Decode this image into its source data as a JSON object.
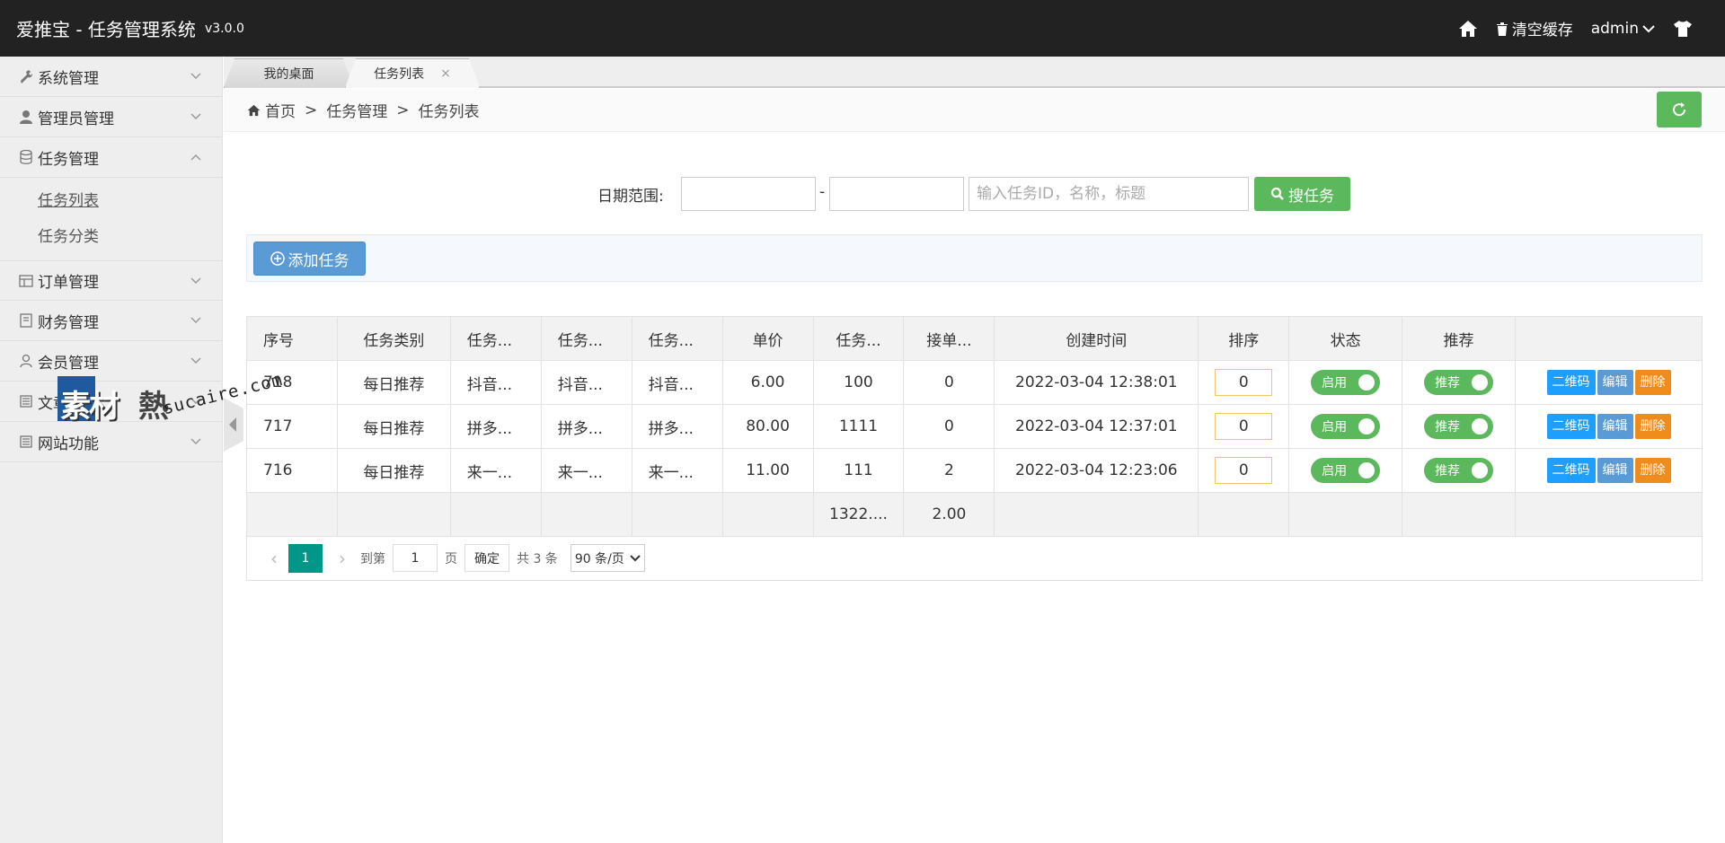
{
  "header": {
    "brand": "爱推宝 - 任务管理系统",
    "version": "v3.0.0",
    "clear_cache": "清空缓存",
    "user": "admin"
  },
  "sidebar": {
    "items": [
      {
        "label": "系统管理",
        "icon": "wrench-icon"
      },
      {
        "label": "管理员管理",
        "icon": "user-icon"
      },
      {
        "label": "任务管理",
        "icon": "database-icon"
      },
      {
        "label": "订单管理",
        "icon": "table-icon"
      },
      {
        "label": "财务管理",
        "icon": "book-icon"
      },
      {
        "label": "会员管理",
        "icon": "member-icon"
      },
      {
        "label": "文章管理",
        "icon": "list-icon"
      },
      {
        "label": "网站功能",
        "icon": "list-icon"
      }
    ],
    "sub_items": [
      {
        "label": "任务列表"
      },
      {
        "label": "任务分类"
      }
    ]
  },
  "watermark": {
    "text_cn": "素材",
    "text_cn2": "熱",
    "url": "sucaire.com"
  },
  "tabs": [
    {
      "label": "我的桌面"
    },
    {
      "label": "任务列表",
      "close": "×"
    }
  ],
  "breadcrumb": {
    "home": "首页",
    "sep": ">",
    "level1": "任务管理",
    "level2": "任务列表"
  },
  "search": {
    "date_label": "日期范围:",
    "dash": "-",
    "keyword_placeholder": "输入任务ID，名称，标题",
    "button": "搜任务"
  },
  "actions": {
    "add": "添加任务"
  },
  "table": {
    "headers": [
      "序号",
      "任务类别",
      "任务...",
      "任务...",
      "任务...",
      "单价",
      "任务...",
      "接单...",
      "创建时间",
      "排序",
      "状态",
      "推荐",
      ""
    ],
    "rows": [
      {
        "id": "718",
        "category": "每日推荐",
        "c1": "抖音...",
        "c2": "抖音...",
        "c3": "抖音...",
        "price": "6.00",
        "qty": "100",
        "taken": "0",
        "created": "2022-03-04 12:38:01",
        "sort": "0",
        "status": "启用",
        "recommend": "推荐"
      },
      {
        "id": "717",
        "category": "每日推荐",
        "c1": "拼多...",
        "c2": "拼多...",
        "c3": "拼多...",
        "price": "80.00",
        "qty": "1111",
        "taken": "0",
        "created": "2022-03-04 12:37:01",
        "sort": "0",
        "status": "启用",
        "recommend": "推荐"
      },
      {
        "id": "716",
        "category": "每日推荐",
        "c1": "来一...",
        "c2": "来一...",
        "c3": "来一...",
        "price": "11.00",
        "qty": "111",
        "taken": "2",
        "created": "2022-03-04 12:23:06",
        "sort": "0",
        "status": "启用",
        "recommend": "推荐"
      }
    ],
    "ops": {
      "qr": "二维码",
      "edit": "编辑",
      "del": "删除"
    },
    "total": {
      "qty": "1322....",
      "taken": "2.00"
    }
  },
  "pager": {
    "prev": "‹",
    "current": "1",
    "next": "›",
    "goto": "到第",
    "page_value": "1",
    "page_unit": "页",
    "confirm": "确定",
    "total": "共 3 条",
    "per_page": "90 条/页"
  },
  "colors": {
    "topbar": "#222222",
    "green": "#5cb85c",
    "pager_active": "#009688",
    "qr": "#1e9fff",
    "edit": "#5b9bd5",
    "delete": "#f08c1c"
  }
}
